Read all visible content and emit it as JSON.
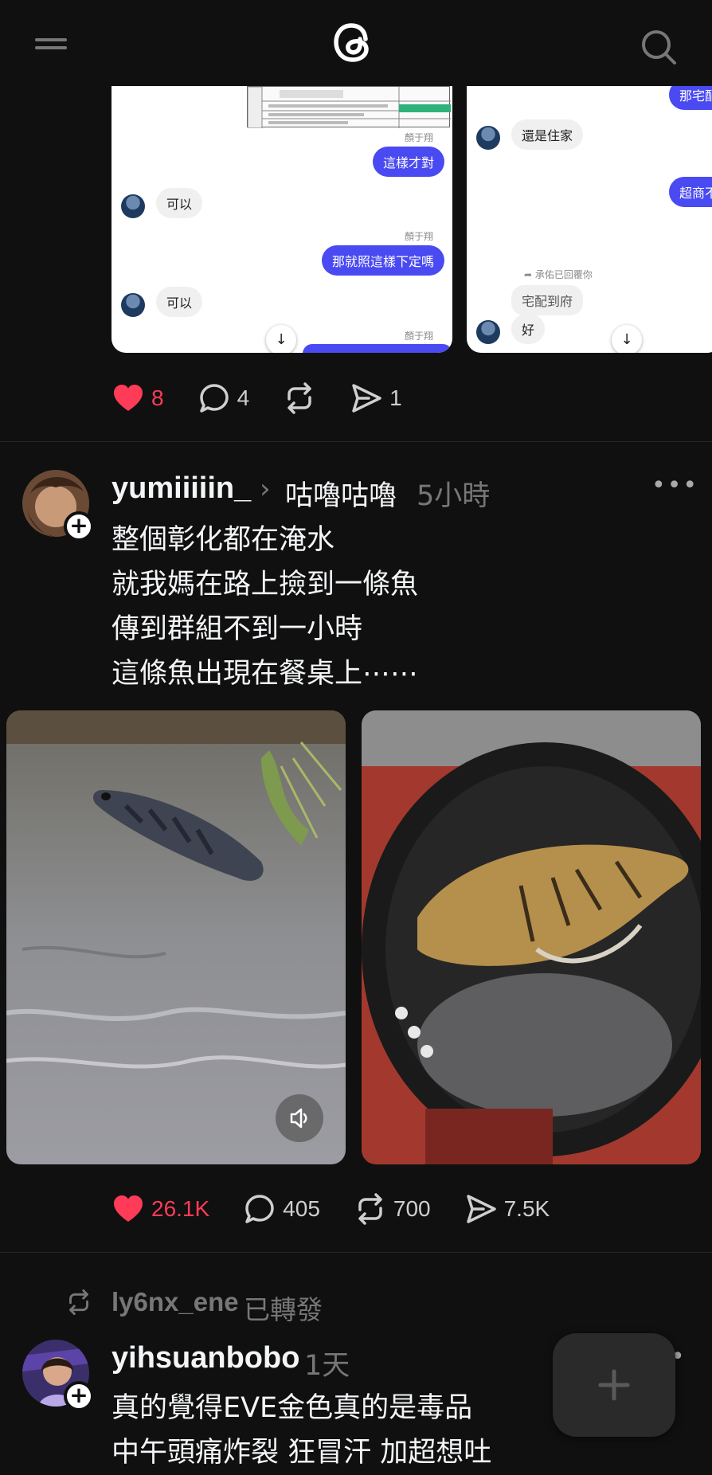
{
  "colors": {
    "background": "#101010",
    "liked": "#ff3b57",
    "bubble_blue": "#4a4af2"
  },
  "carousel1": {
    "chat1": {
      "sender1": "顏于翔",
      "msg1": "這樣才對",
      "reply1": "可以",
      "sender2": "顏于翔",
      "msg2": "那就照這樣下定嗎",
      "reply2": "可以",
      "sender3": "顏于翔"
    },
    "chat2": {
      "msg_top": "那宅配",
      "reply1": "還是住家",
      "msg_mid": "超商不",
      "reply_note": "承佑已回覆你",
      "quote": "宅配到府",
      "reply2": "好"
    }
  },
  "post1_actions": {
    "likes": "8",
    "replies": "4",
    "reposts": "",
    "shares": "1"
  },
  "post2": {
    "username": "yumiiiiin_",
    "topic": "咕嚕咕嚕",
    "time": "5小時",
    "lines": [
      "整個彰化都在淹水",
      "就我媽在路上撿到一條魚",
      "傳到群組不到一小時",
      "這條魚出現在餐桌上⋯⋯"
    ],
    "actions": {
      "likes": "26.1K",
      "replies": "405",
      "reposts": "700",
      "shares": "7.5K"
    }
  },
  "post3": {
    "reposted_by": "ly6nx_ene",
    "reposted_label": "已轉發",
    "username": "yihsuanbobo",
    "time": "1天",
    "lines": [
      "真的覺得EVE金色真的是毒品",
      "中午頭痛炸裂 狂冒汗 加超想吐"
    ]
  },
  "icons": {
    "menu": "menu-icon",
    "logo": "threads-logo",
    "search": "search-icon",
    "like": "heart-icon",
    "reply": "comment-icon",
    "repost": "repost-icon",
    "share": "share-icon",
    "sound": "volume-icon",
    "compose": "plus-icon"
  }
}
